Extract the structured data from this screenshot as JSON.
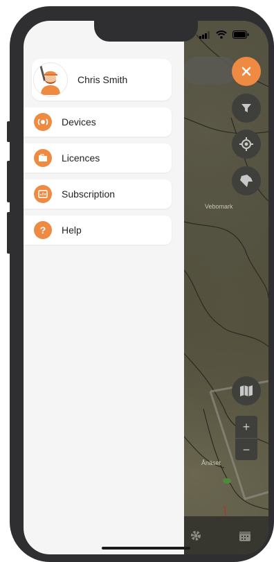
{
  "status_bar": {
    "icons": [
      "signal-icon",
      "wifi-icon",
      "battery-icon"
    ]
  },
  "profile": {
    "name": "Chris Smith",
    "avatar_icon": "hunter-avatar-icon"
  },
  "menu": {
    "items": [
      {
        "label": "Devices",
        "icon": "device-icon"
      },
      {
        "label": "Licences",
        "icon": "folder-icon"
      },
      {
        "label": "Subscription",
        "icon": "subscription-icon"
      },
      {
        "label": "Help",
        "icon": "help-icon"
      }
    ]
  },
  "map": {
    "labels": [
      "Vebomark",
      "Ånäset"
    ],
    "controls": [
      "close-icon",
      "filter-icon",
      "locate-icon",
      "dog-icon",
      "map-layers-icon"
    ],
    "zoom_in": "+",
    "zoom_out": "−"
  },
  "colors": {
    "accent": "#ef8a43",
    "drawer_bg": "#f5f5f5",
    "map_control_bg": "#3f3f3c"
  }
}
